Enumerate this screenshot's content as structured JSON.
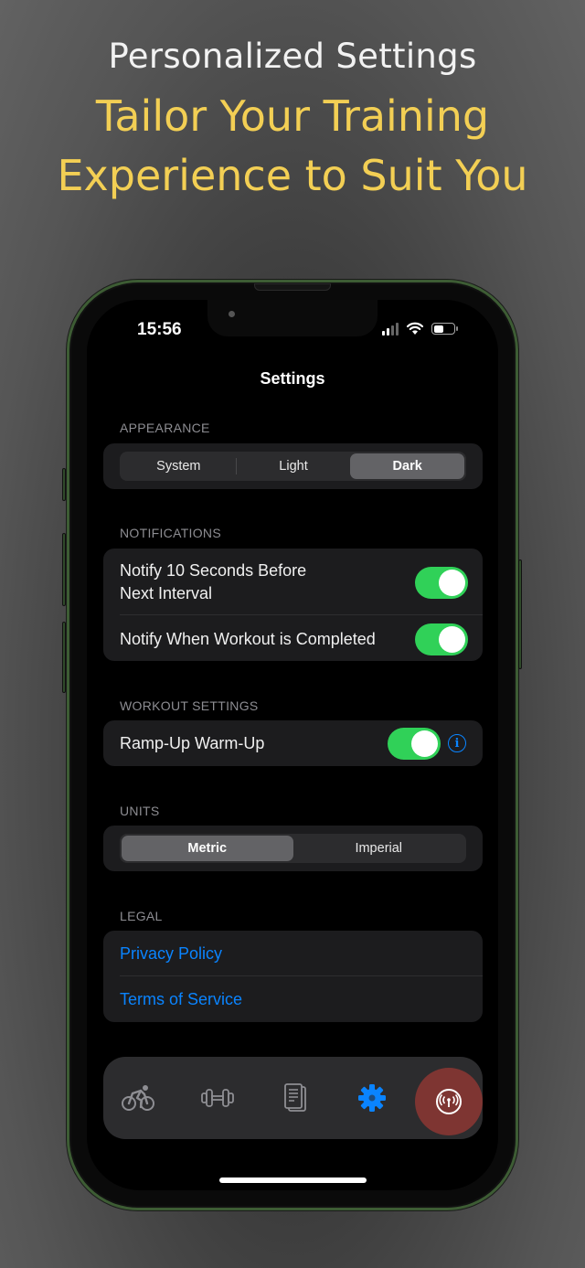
{
  "headline": {
    "line1": "Personalized Settings",
    "line2": "Tailor Your Training",
    "line3": "Experience to Suit You"
  },
  "status_bar": {
    "time": "15:56",
    "icons": [
      "cellular-signal-icon",
      "wifi-icon",
      "battery-icon"
    ]
  },
  "nav": {
    "title": "Settings"
  },
  "appearance": {
    "header": "APPEARANCE",
    "options": [
      "System",
      "Light",
      "Dark"
    ],
    "selected": "Dark"
  },
  "notifications": {
    "header": "NOTIFICATIONS",
    "items": [
      {
        "label_line1": "Notify 10 Seconds Before",
        "label_line2": "Next Interval",
        "enabled": true
      },
      {
        "label": "Notify When Workout is Completed",
        "enabled": true
      }
    ]
  },
  "workout_settings": {
    "header": "WORKOUT SETTINGS",
    "items": [
      {
        "label": "Ramp-Up Warm-Up",
        "enabled": true,
        "info_icon": "info-circle-icon"
      }
    ]
  },
  "units": {
    "header": "UNITS",
    "options": [
      "Metric",
      "Imperial"
    ],
    "selected": "Metric"
  },
  "legal": {
    "header": "LEGAL",
    "links": [
      "Privacy Policy",
      "Terms of Service"
    ]
  },
  "tab_bar": {
    "tabs": [
      {
        "icon": "cycling-icon",
        "active": false
      },
      {
        "icon": "dumbbell-icon",
        "active": false
      },
      {
        "icon": "document-icon",
        "active": false
      },
      {
        "icon": "gear-icon",
        "active": true
      }
    ],
    "action_button_icon": "broadcast-icon"
  },
  "colors": {
    "accent_yellow": "#f3cf54",
    "toggle_green": "#30d158",
    "link_blue": "#0a84ff",
    "action_red": "#7e3532",
    "frame_green": "#3d5c34"
  }
}
